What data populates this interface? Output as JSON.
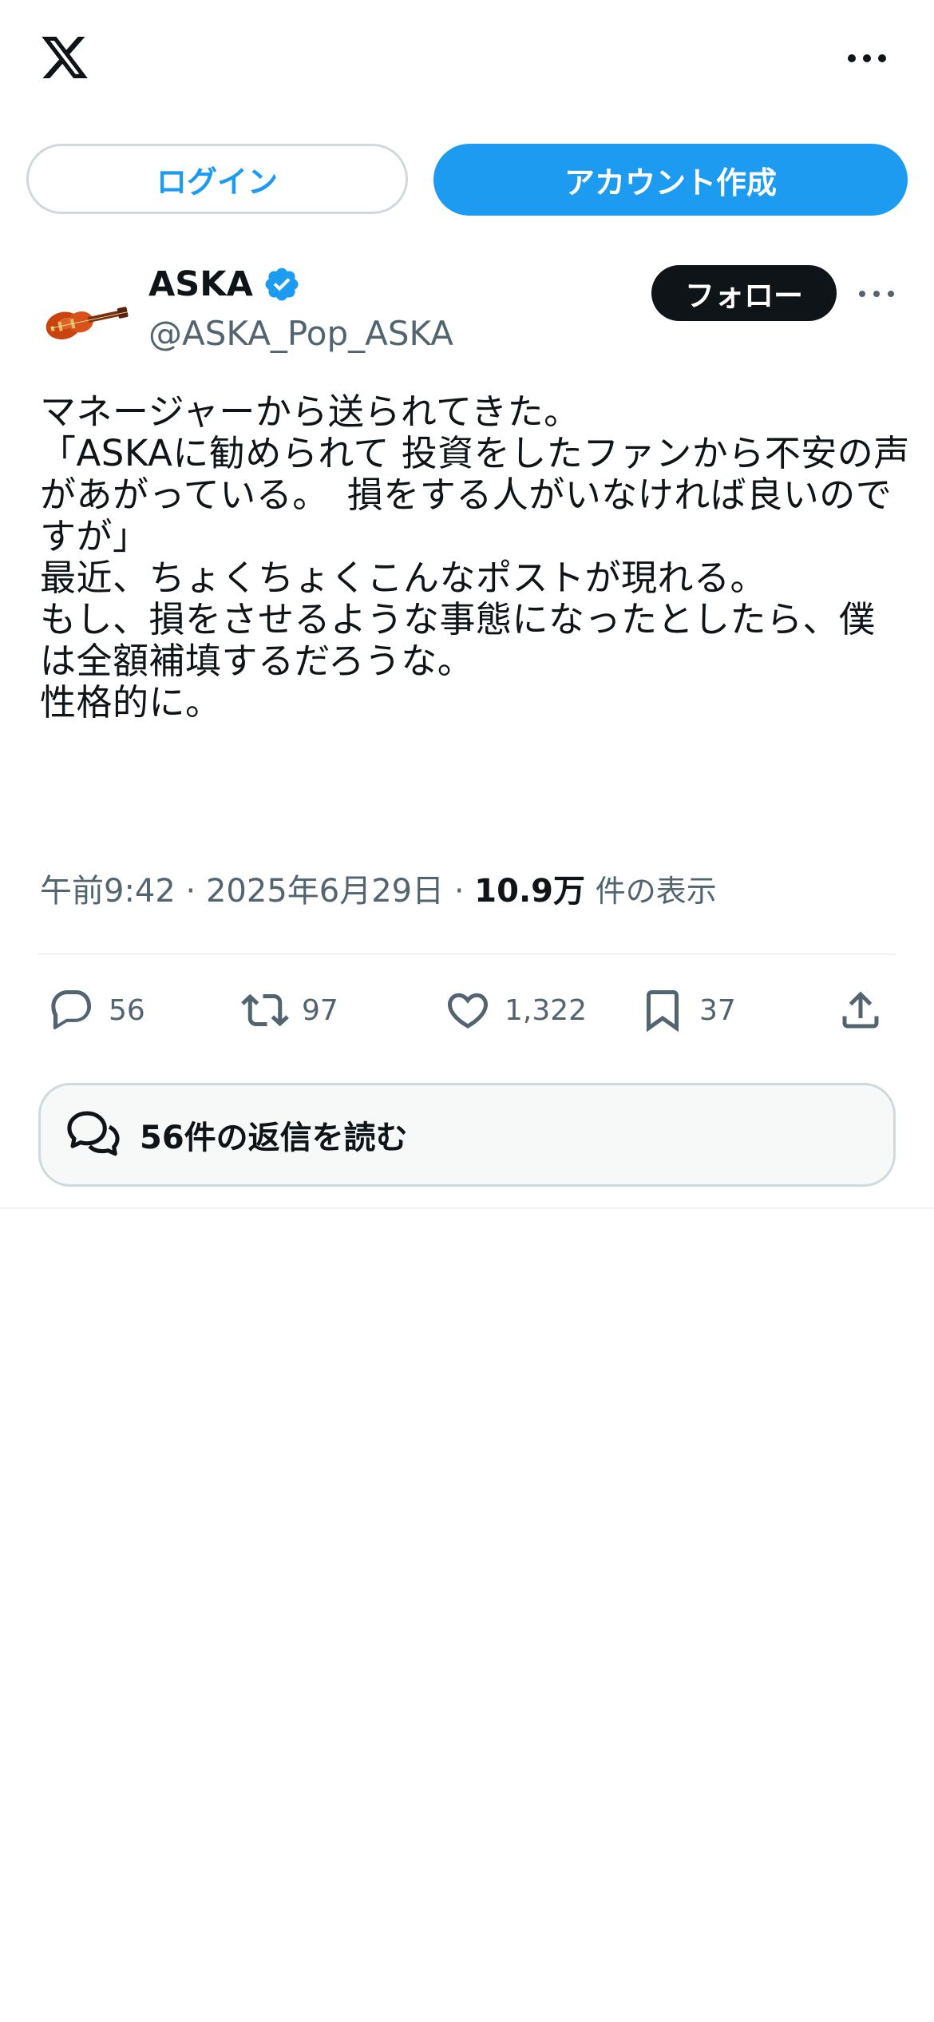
{
  "header": {
    "logo_icon": "x-logo-icon",
    "more_icon": "more-horizontal-icon"
  },
  "auth": {
    "login_label": "ログイン",
    "signup_label": "アカウント作成"
  },
  "post": {
    "author_name": "ASKA",
    "verified_icon": "verified-badge-icon",
    "author_handle": "@ASKA_Pop_ASKA",
    "follow_label": "フォロー",
    "text": "マネージャーから送られてきた。\n「ASKAに勧められて 投資をしたファンから不安の声があがっている。　損をする人がいなければ良いのですが」\n最近、ちょくちょくこんなポストが現れる。\nもし、損をさせるような事態になったとしたら、僕は全額補填するだろうな。\n性格的に。",
    "time": "午前9:42",
    "date": "2025年6月29日",
    "views_count": "10.9万",
    "views_label": "件の表示",
    "separator": "·"
  },
  "actions": {
    "reply_count": "56",
    "repost_count": "97",
    "like_count": "1,322",
    "bookmark_count": "37"
  },
  "replies": {
    "label": "56件の返信を読む"
  },
  "colors": {
    "accent": "#1d9bf0",
    "text_primary": "#0f1419",
    "text_secondary": "#536471",
    "border": "#cfd9de"
  }
}
